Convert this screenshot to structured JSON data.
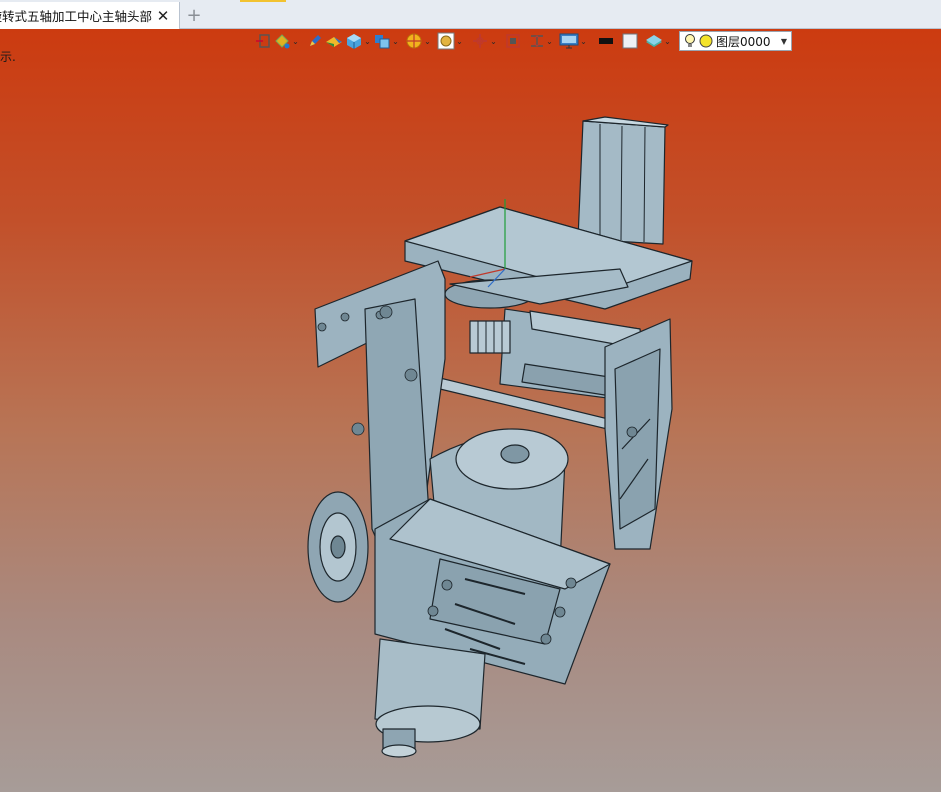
{
  "tab": {
    "title": "旋转式五轴加工中心主轴头部]",
    "close_glyph": "✕",
    "add_glyph": "+"
  },
  "viewport": {
    "hint_text": "示."
  },
  "toolbar": {
    "layer": {
      "name": "图层0000",
      "dropdown_glyph": "▼"
    },
    "caret_glyph": "⌄"
  },
  "colors": {
    "model_fill": "#9db4c1",
    "model_edge": "#1d262c",
    "background_top": "#cc3b10",
    "background_bottom": "#a79c98"
  },
  "icons": [
    "window-icon",
    "paint-bucket-icon",
    "pen-icon",
    "material-icon",
    "cube-icon",
    "cube-set-icon",
    "section-icon",
    "render-icon",
    "move-icon",
    "frame-icon",
    "dimension-icon",
    "display-icon",
    "black-line-icon",
    "white-fill-icon",
    "layer-icon",
    "lightbulb-icon",
    "layer-color-icon"
  ]
}
